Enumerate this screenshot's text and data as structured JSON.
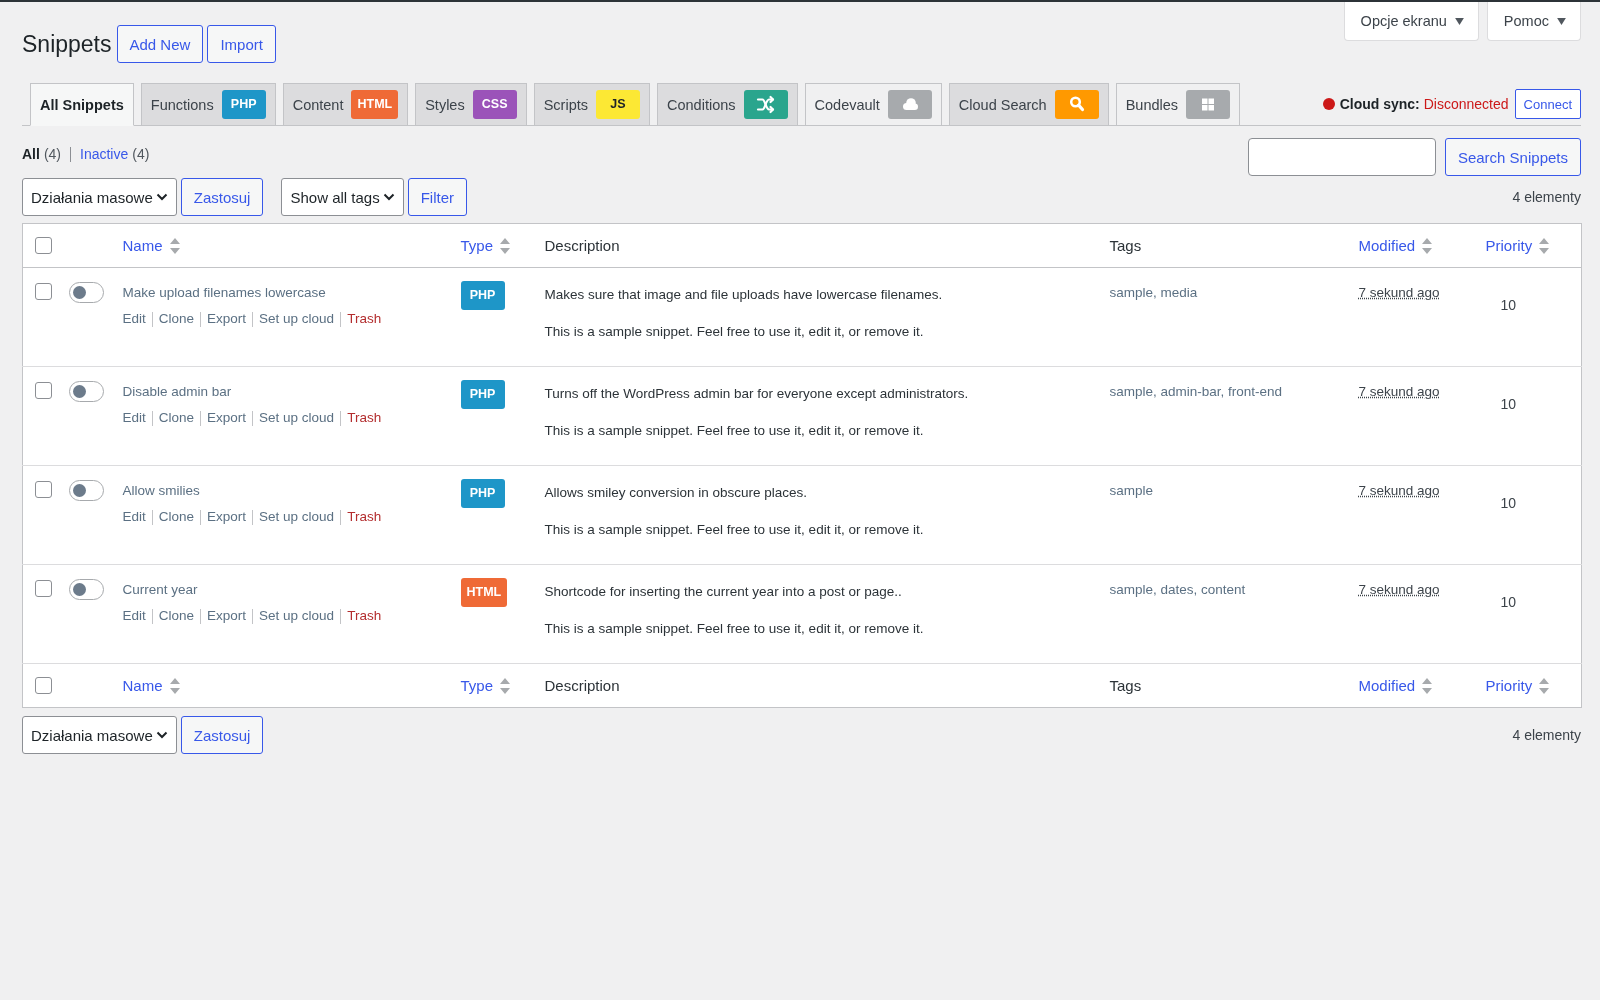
{
  "page_title": "Snippets",
  "title_buttons": [
    "Add New",
    "Import"
  ],
  "screen_meta": [
    {
      "label": "Opcje ekranu"
    },
    {
      "label": "Pomoc"
    }
  ],
  "tabs": [
    {
      "label": "All Snippets",
      "selected": true,
      "kind": "all"
    },
    {
      "label": "Functions",
      "selected": false,
      "kind": "type",
      "badge": {
        "kind": "text",
        "label": "PHP",
        "color": "#1e96c8"
      }
    },
    {
      "label": "Content",
      "selected": false,
      "kind": "type",
      "badge": {
        "kind": "text",
        "label": "HTML",
        "color": "#ef6a36"
      }
    },
    {
      "label": "Styles",
      "selected": false,
      "kind": "type",
      "badge": {
        "kind": "text",
        "label": "CSS",
        "color": "#9b53b9"
      }
    },
    {
      "label": "Scripts",
      "selected": false,
      "kind": "type",
      "badge": {
        "kind": "text",
        "label": "JS",
        "color": "#fce834"
      }
    },
    {
      "label": "Conditions",
      "selected": false,
      "kind": "type",
      "badge": {
        "kind": "shuffle",
        "color": "#2aa58d"
      }
    },
    {
      "label": "Codevault",
      "selected": false,
      "kind": "link",
      "badge": {
        "kind": "cloud",
        "color": "#a7aaad"
      }
    },
    {
      "label": "Cloud Search",
      "selected": false,
      "kind": "type",
      "badge": {
        "kind": "search",
        "color": "#ff9900"
      }
    },
    {
      "label": "Bundles",
      "selected": false,
      "kind": "link",
      "badge": {
        "kind": "grid",
        "color": "#a7aaad"
      }
    }
  ],
  "cloud_sync": {
    "label": "Cloud sync:",
    "status": "Disconnected",
    "connected": false,
    "button": "Connect"
  },
  "views": [
    {
      "label": "All",
      "count": "(4)",
      "selected": true
    },
    {
      "label": "Inactive",
      "count": "(4)",
      "selected": false
    }
  ],
  "search": {
    "button": "Search Snippets"
  },
  "bulk_actions_top": {
    "select": "Działania masowe",
    "apply": "Zastosuj"
  },
  "tag_filter": {
    "select": "Show all tags",
    "button": "Filter"
  },
  "item_count_top": "4 elementy",
  "table": {
    "select_all_checked": false,
    "columns": [
      {
        "label": "Name",
        "sortable": true
      },
      {
        "label": "Type",
        "sortable": true
      },
      {
        "label": "Description",
        "sortable": false
      },
      {
        "label": "Tags",
        "sortable": false
      },
      {
        "label": "Modified",
        "sortable": true
      },
      {
        "label": "Priority",
        "sortable": true
      }
    ],
    "rows": [
      {
        "checked": false,
        "active": false,
        "name": "Make upload filenames lowercase",
        "actions": [
          {
            "label": "Edit",
            "kind": "link"
          },
          {
            "label": "Clone",
            "kind": "link"
          },
          {
            "label": "Export",
            "kind": "link"
          },
          {
            "label": "Set up cloud",
            "kind": "link"
          },
          {
            "label": "Trash",
            "kind": "trash"
          }
        ],
        "type": {
          "label": "PHP",
          "color": "#1e96c8"
        },
        "description": "Makes sure that image and file uploads have lowercase filenames.",
        "note": "This is a sample snippet. Feel free to use it, edit it, or remove it.",
        "tags": "sample, media",
        "modified": "7 sekund ago",
        "priority": "10"
      },
      {
        "checked": false,
        "active": false,
        "name": "Disable admin bar",
        "actions": [
          {
            "label": "Edit",
            "kind": "link"
          },
          {
            "label": "Clone",
            "kind": "link"
          },
          {
            "label": "Export",
            "kind": "link"
          },
          {
            "label": "Set up cloud",
            "kind": "link"
          },
          {
            "label": "Trash",
            "kind": "trash"
          }
        ],
        "type": {
          "label": "PHP",
          "color": "#1e96c8"
        },
        "description": "Turns off the WordPress admin bar for everyone except administrators.",
        "note": "This is a sample snippet. Feel free to use it, edit it, or remove it.",
        "tags": "sample, admin-bar, front-end",
        "modified": "7 sekund ago",
        "priority": "10"
      },
      {
        "checked": false,
        "active": false,
        "name": "Allow smilies",
        "actions": [
          {
            "label": "Edit",
            "kind": "link"
          },
          {
            "label": "Clone",
            "kind": "link"
          },
          {
            "label": "Export",
            "kind": "link"
          },
          {
            "label": "Set up cloud",
            "kind": "link"
          },
          {
            "label": "Trash",
            "kind": "trash"
          }
        ],
        "type": {
          "label": "PHP",
          "color": "#1e96c8"
        },
        "description": "Allows smiley conversion in obscure places.",
        "note": "This is a sample snippet. Feel free to use it, edit it, or remove it.",
        "tags": "sample",
        "modified": "7 sekund ago",
        "priority": "10"
      },
      {
        "checked": false,
        "active": false,
        "name": "Current year",
        "actions": [
          {
            "label": "Edit",
            "kind": "link"
          },
          {
            "label": "Clone",
            "kind": "link"
          },
          {
            "label": "Export",
            "kind": "link"
          },
          {
            "label": "Set up cloud",
            "kind": "link"
          },
          {
            "label": "Trash",
            "kind": "trash"
          }
        ],
        "type": {
          "label": "HTML",
          "color": "#ef6a36"
        },
        "description": "Shortcode for inserting the current year into a post or page..",
        "note": "This is a sample snippet. Feel free to use it, edit it, or remove it.",
        "tags": "sample, dates, content",
        "modified": "7 sekund ago",
        "priority": "10"
      }
    ],
    "footer_select_all_checked": false,
    "footer_columns": [
      {
        "label": "Name",
        "sortable": true
      },
      {
        "label": "Type",
        "sortable": true
      },
      {
        "label": "Description",
        "sortable": false
      },
      {
        "label": "Tags",
        "sortable": false
      },
      {
        "label": "Modified",
        "sortable": true
      },
      {
        "label": "Priority",
        "sortable": true
      }
    ]
  },
  "bulk_actions_bottom": {
    "select": "Działania masowe",
    "apply": "Zastosuj"
  },
  "item_count_bottom": "4 elementy"
}
